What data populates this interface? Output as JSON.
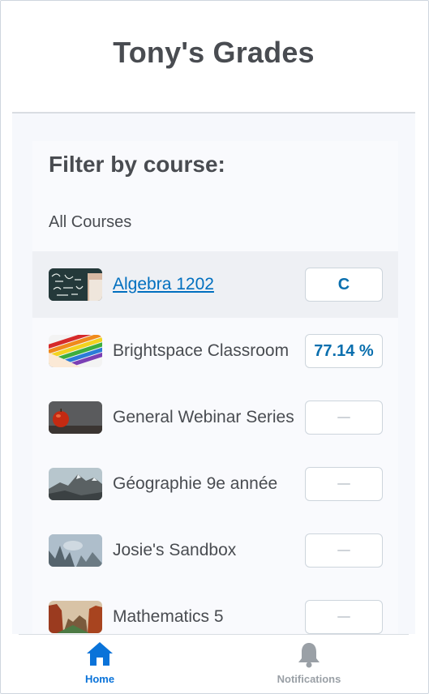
{
  "header": {
    "title": "Tony's Grades"
  },
  "filter": {
    "title": "Filter by course:",
    "selected": "All Courses"
  },
  "courses": [
    {
      "name": "Algebra 1202",
      "grade": "C",
      "link": true,
      "thumb": "chalkboard-image"
    },
    {
      "name": "Brightspace Classroom",
      "grade": "77.14 %",
      "link": false,
      "thumb": "colored-pencils-image"
    },
    {
      "name": "General Webinar Series",
      "grade": "",
      "link": false,
      "thumb": "apple-image"
    },
    {
      "name": "Géographie 9e année",
      "grade": "",
      "link": false,
      "thumb": "mountain-image"
    },
    {
      "name": "Josie's Sandbox",
      "grade": "",
      "link": false,
      "thumb": "misty-forest-image"
    },
    {
      "name": "Mathematics 5",
      "grade": "",
      "link": false,
      "thumb": "canyon-image"
    }
  ],
  "tabbar": {
    "home_label": "Home",
    "notifications_label": "Notifications"
  },
  "colors": {
    "accent": "#006fbf",
    "grade_text": "#0a6fae",
    "inactive_tab": "#9aa0a6"
  }
}
